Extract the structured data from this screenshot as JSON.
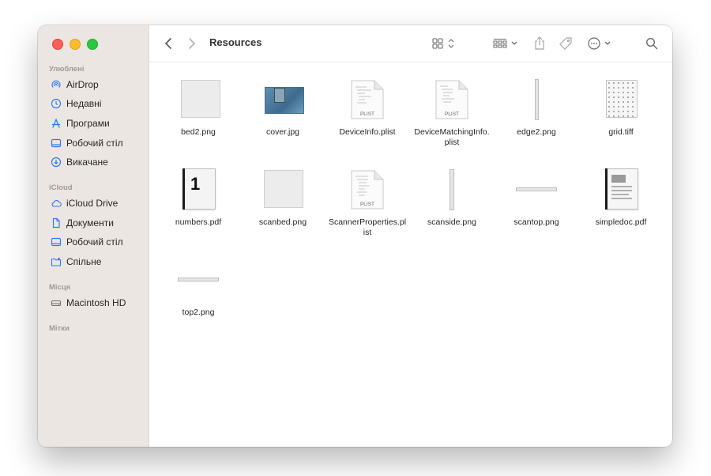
{
  "window": {
    "title": "Resources"
  },
  "sidebar": {
    "favorites_header": "Улюблені",
    "favorites": [
      {
        "label": "AirDrop",
        "icon": "airdrop-icon"
      },
      {
        "label": "Недавні",
        "icon": "clock-icon"
      },
      {
        "label": "Програми",
        "icon": "applications-icon"
      },
      {
        "label": "Робочий стіл",
        "icon": "desktop-icon"
      },
      {
        "label": "Викачане",
        "icon": "download-icon"
      }
    ],
    "icloud_header": "iCloud",
    "icloud": [
      {
        "label": "iCloud Drive",
        "icon": "cloud-icon"
      },
      {
        "label": "Документи",
        "icon": "document-icon"
      },
      {
        "label": "Робочий стіл",
        "icon": "desktop-icon"
      },
      {
        "label": "Спільне",
        "icon": "shared-folder-icon"
      }
    ],
    "locations_header": "Місця",
    "locations": [
      {
        "label": "Macintosh HD",
        "icon": "disk-icon"
      }
    ],
    "tags_header": "Мітки"
  },
  "files": [
    {
      "name": "bed2.png",
      "kind": "blank-image"
    },
    {
      "name": "cover.jpg",
      "kind": "photo"
    },
    {
      "name": "DeviceInfo.plist",
      "kind": "plist",
      "badge": "PLIST"
    },
    {
      "name": "DeviceMatchingInfo.plist",
      "kind": "plist",
      "badge": "PLIST"
    },
    {
      "name": "edge2.png",
      "kind": "vertical-strip"
    },
    {
      "name": "grid.tiff",
      "kind": "grid-image"
    },
    {
      "name": "numbers.pdf",
      "kind": "numbers-pdf",
      "glyph": "1"
    },
    {
      "name": "scanbed.png",
      "kind": "blank-image"
    },
    {
      "name": "ScannerProperties.plist",
      "kind": "plist",
      "badge": "PLIST"
    },
    {
      "name": "scanside.png",
      "kind": "vertical-strip"
    },
    {
      "name": "scantop.png",
      "kind": "horizontal-strip"
    },
    {
      "name": "simpledoc.pdf",
      "kind": "doc-pdf"
    },
    {
      "name": "top2.png",
      "kind": "horizontal-strip"
    }
  ],
  "colors": {
    "sidebar_bg": "#ece6e2",
    "accent": "#2f7bf5"
  }
}
